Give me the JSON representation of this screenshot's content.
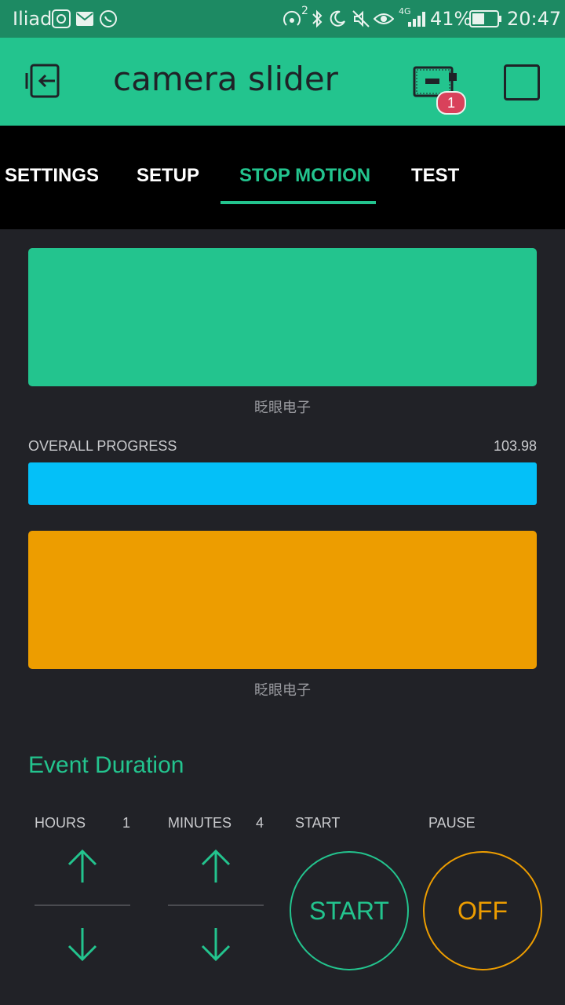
{
  "status_bar": {
    "carrier": "Iliad",
    "battery_percent": "41%",
    "time": "20:47",
    "network": "4G",
    "sim_index": "2"
  },
  "header": {
    "title": "camera slider",
    "device_badge_count": "1"
  },
  "tabs": [
    {
      "label": "SETTINGS",
      "active": false
    },
    {
      "label": "SETUP",
      "active": false
    },
    {
      "label": "STOP MOTION",
      "active": true
    },
    {
      "label": "TEST",
      "active": false
    }
  ],
  "widgets": {
    "green_panel": {
      "color": "#23c48e",
      "caption": "眨眼电子"
    },
    "progress": {
      "label": "OVERALL PROGRESS",
      "value": "103.98",
      "color": "#04c0f8"
    },
    "orange_panel": {
      "color": "#ed9d00",
      "caption": "眨眼电子"
    }
  },
  "event_duration": {
    "title": "Event Duration",
    "hours": {
      "label": "HOURS",
      "value": "1"
    },
    "minutes": {
      "label": "MINUTES",
      "value": "4"
    },
    "start": {
      "label": "START",
      "button": "START",
      "color": "#23c48e"
    },
    "pause": {
      "label": "PAUSE",
      "button": "OFF",
      "color": "#ed9d00"
    }
  }
}
